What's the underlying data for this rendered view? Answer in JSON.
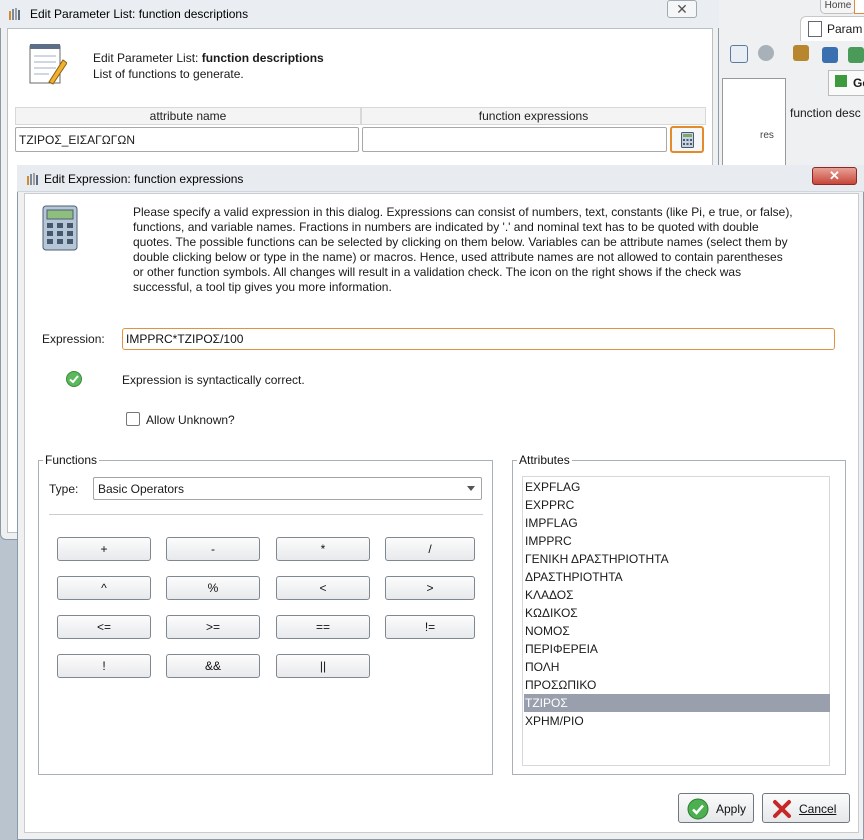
{
  "background_app": {
    "tab_home": "Home",
    "tab_param": "Param",
    "generate_label": "Ge",
    "desc_label": "function desc",
    "res_label": "res"
  },
  "param_dialog": {
    "title": "Edit Parameter List: function descriptions",
    "header_prefix": "Edit Parameter List: ",
    "header_bold": "function descriptions",
    "header_sub": "List of functions to generate.",
    "columns": [
      "attribute name",
      "function expressions"
    ],
    "row": {
      "attribute": "ΤΖΙΡΟΣ_ΕΙΣΑΓΩΓΩΝ",
      "expression": ""
    }
  },
  "expr_dialog": {
    "title": "Edit Expression: function expressions",
    "info_lines": [
      "Please specify a valid expression in this dialog. Expressions can consist of numbers, text, constants (like Pi, e true, or false),",
      "functions, and variable names. Fractions in numbers are indicated by '.' and nominal text has to be quoted with double",
      "quotes. The possible functions can be selected by clicking on them below. Variables can be attribute names (select them by",
      "double clicking below or type in the name) or macros. Hence, used attribute names are not allowed to contain parentheses",
      "or other function symbols. All changes will result in a validation check. The icon on the right shows if the check was",
      "successful, a tool tip gives you more information."
    ],
    "expression_label": "Expression:",
    "expression_value": "IMPPRC*ΤΖΙΡΟΣ/100",
    "status": "Expression is syntactically correct.",
    "allow_unknown": "Allow Unknown?",
    "functions_legend": "Functions",
    "type_label": "Type:",
    "type_value": "Basic Operators",
    "operators": [
      "+",
      "-",
      "*",
      "/",
      "^",
      "%",
      "<",
      ">",
      "<=",
      ">=",
      "==",
      "!=",
      "!",
      "&&",
      "||"
    ],
    "attributes_legend": "Attributes",
    "attributes": [
      "EXPFLAG",
      "EXPPRC",
      "IMPFLAG",
      "IMPPRC",
      "ΓΕΝΙΚΗ ΔΡΑΣΤΗΡΙΟΤΗΤΑ",
      "ΔΡΑΣΤΗΡΙΟΤΗΤΑ",
      "ΚΛΑΔΟΣ",
      "ΚΩΔΙΚΟΣ",
      "ΝΟΜΟΣ",
      "ΠΕΡΙΦΕΡΕΙΑ",
      "ΠΟΛΗ",
      "ΠΡΟΣΩΠΙΚΟ",
      "ΤΖΙΡΟΣ",
      "ΧΡΗΜ/ΡΙΟ"
    ],
    "selected_attribute": "ΤΖΙΡΟΣ",
    "apply": "Apply",
    "cancel": "Cancel"
  },
  "colors": {
    "accent_orange": "#e58a2a",
    "selection": "#9a9fae",
    "ok_green": "#4caf50",
    "cancel_red": "#c62828"
  }
}
